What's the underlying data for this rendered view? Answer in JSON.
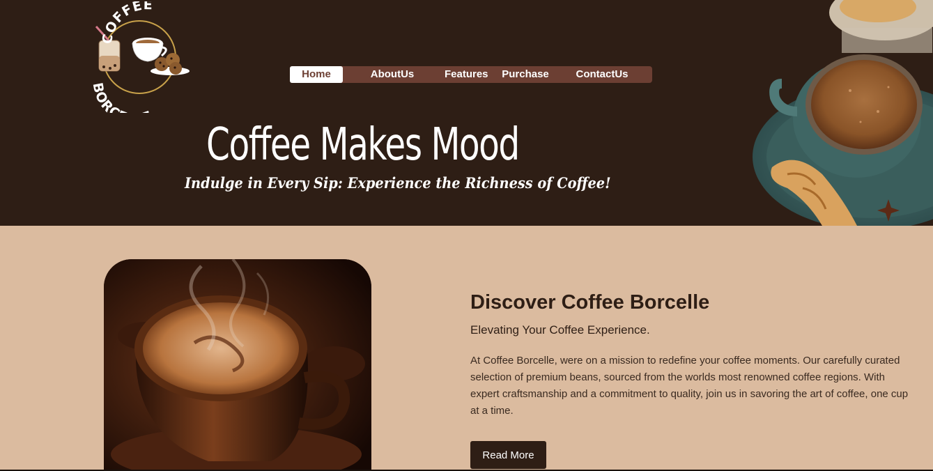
{
  "brand": {
    "logo_top": "COFFEE",
    "logo_bottom": "BORCELLE"
  },
  "nav": {
    "items": [
      {
        "label": "Home",
        "active": true
      },
      {
        "label": "AboutUs",
        "active": false
      },
      {
        "label": "Features",
        "active": false
      },
      {
        "label": "Purchase",
        "active": false
      },
      {
        "label": "ContactUs",
        "active": false
      }
    ]
  },
  "hero": {
    "title": "Coffee Makes Mood",
    "subtitle": "Indulge in Every Sip: Experience the Richness of Coffee!"
  },
  "about": {
    "heading": "Discover Coffee Borcelle",
    "subheading": "Elevating Your Coffee Experience.",
    "body": "At Coffee Borcelle, were on a mission to redefine your coffee moments. Our carefully curated selection of premium beans, sourced from the worlds most renowned coffee regions. With expert craftsmanship and a commitment to quality, join us in savoring the art of coffee, one cup at a time.",
    "button_label": "Read More"
  },
  "colors": {
    "hero_bg": "#2e1e15",
    "nav_bg": "#6c3f33",
    "section_bg": "#dbbb9f",
    "button_bg": "#2e1e15",
    "text_dark": "#2e1e15"
  },
  "icons": {
    "logo": "coffee-cup-cookies-logo",
    "hero_image": "cappuccino-cup-croissant-image",
    "about_image": "steaming-coffee-cup-image"
  }
}
